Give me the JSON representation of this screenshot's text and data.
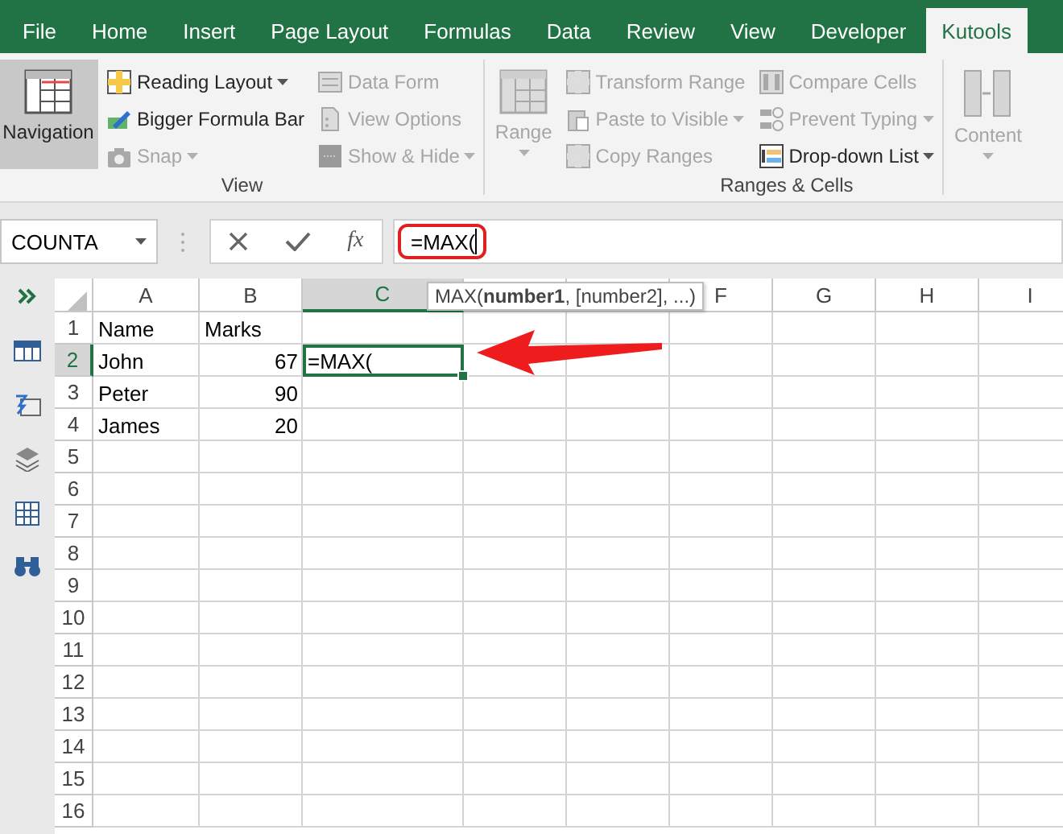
{
  "tabs": [
    {
      "label": "File",
      "selected": false
    },
    {
      "label": "Home",
      "selected": false
    },
    {
      "label": "Insert",
      "selected": false
    },
    {
      "label": "Page Layout",
      "selected": false
    },
    {
      "label": "Formulas",
      "selected": false
    },
    {
      "label": "Data",
      "selected": false
    },
    {
      "label": "Review",
      "selected": false
    },
    {
      "label": "View",
      "selected": false
    },
    {
      "label": "Developer",
      "selected": false
    },
    {
      "label": "Kutools",
      "selected": true
    }
  ],
  "ribbon": {
    "groups": [
      {
        "label": "View",
        "items": [
          {
            "label": "Navigation",
            "kind": "large",
            "selected": true,
            "disabled": false,
            "dropdown": false
          },
          {
            "label": "Reading Layout",
            "kind": "small",
            "selected": false,
            "disabled": false,
            "dropdown": true
          },
          {
            "label": "Bigger Formula Bar",
            "kind": "small",
            "selected": false,
            "disabled": false,
            "dropdown": false
          },
          {
            "label": "Snap",
            "kind": "small",
            "selected": false,
            "disabled": true,
            "dropdown": true
          },
          {
            "label": "Data Form",
            "kind": "small",
            "selected": false,
            "disabled": true,
            "dropdown": false
          },
          {
            "label": "View Options",
            "kind": "small",
            "selected": false,
            "disabled": true,
            "dropdown": false
          },
          {
            "label": "Show & Hide",
            "kind": "small",
            "selected": false,
            "disabled": true,
            "dropdown": true
          }
        ]
      },
      {
        "label": "Ranges & Cells",
        "items": [
          {
            "label": "Range",
            "kind": "large",
            "selected": false,
            "disabled": true,
            "dropdown": true
          },
          {
            "label": "Transform Range",
            "kind": "small",
            "selected": false,
            "disabled": true,
            "dropdown": false
          },
          {
            "label": "Paste to Visible",
            "kind": "small",
            "selected": false,
            "disabled": true,
            "dropdown": true
          },
          {
            "label": "Copy Ranges",
            "kind": "small",
            "selected": false,
            "disabled": true,
            "dropdown": false
          },
          {
            "label": "Compare Cells",
            "kind": "small",
            "selected": false,
            "disabled": true,
            "dropdown": false
          },
          {
            "label": "Prevent Typing",
            "kind": "small",
            "selected": false,
            "disabled": true,
            "dropdown": true
          },
          {
            "label": "Drop-down List",
            "kind": "small",
            "selected": false,
            "disabled": false,
            "dropdown": true
          }
        ]
      },
      {
        "items": [
          {
            "label": "Content",
            "kind": "large",
            "selected": false,
            "disabled": true,
            "dropdown": true
          }
        ]
      }
    ]
  },
  "formula_bar": {
    "name_box": "COUNTA",
    "insert_function": "fx",
    "formula": "=MAX(",
    "highlighted": true
  },
  "sheet": {
    "columns": [
      {
        "label": "A",
        "selected": false
      },
      {
        "label": "B",
        "selected": false
      },
      {
        "label": "C",
        "selected": true
      },
      {
        "selected": false
      },
      {
        "selected": false
      },
      {
        "label": "F",
        "selected": false
      },
      {
        "label": "G",
        "selected": false
      },
      {
        "label": "H",
        "selected": false
      },
      {
        "label": "I",
        "selected": false
      }
    ],
    "rows": [
      {
        "header": "1",
        "selected": false,
        "cells": [
          {
            "text": "Name",
            "kind": "text"
          },
          {
            "text": "Marks",
            "kind": "text"
          }
        ]
      },
      {
        "header": "2",
        "selected": true,
        "cells": [
          {
            "text": "John",
            "kind": "text"
          },
          {
            "text": "67",
            "kind": "number"
          },
          {
            "text": "=MAX(",
            "kind": "editing"
          }
        ]
      },
      {
        "header": "3",
        "selected": false,
        "cells": [
          {
            "text": "Peter",
            "kind": "text"
          },
          {
            "text": "90",
            "kind": "number"
          }
        ]
      },
      {
        "header": "4",
        "selected": false,
        "cells": [
          {
            "text": "James",
            "kind": "text"
          },
          {
            "text": "20",
            "kind": "number"
          }
        ]
      },
      {
        "header": "5",
        "selected": false
      },
      {
        "header": "6",
        "selected": false
      },
      {
        "header": "7",
        "selected": false
      },
      {
        "header": "8",
        "selected": false
      },
      {
        "header": "9",
        "selected": false
      },
      {
        "header": "10",
        "selected": false
      },
      {
        "header": "11",
        "selected": false
      },
      {
        "header": "12",
        "selected": false
      },
      {
        "header": "13",
        "selected": false
      },
      {
        "header": "14",
        "selected": false
      },
      {
        "header": "15",
        "selected": false
      },
      {
        "header": "16",
        "selected": false
      }
    ],
    "tooltip": "MAX(**number1**, [number2], ...)"
  }
}
